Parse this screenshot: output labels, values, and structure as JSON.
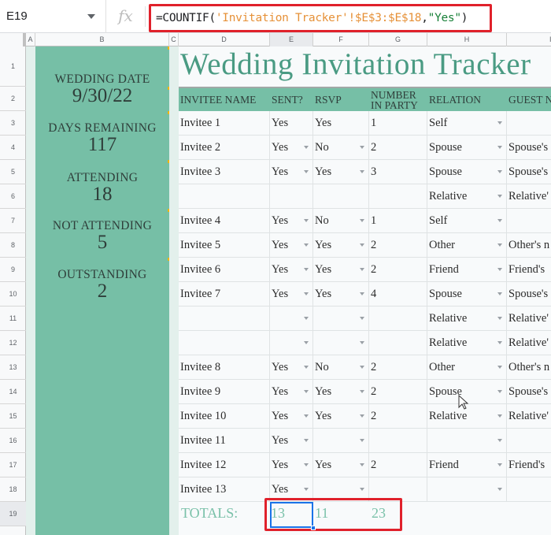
{
  "formula_bar": {
    "name_box": "E19",
    "fx_icon": "fx",
    "formula_prefix": "=COUNTIF(",
    "formula_ref": "'Invitation Tracker'!$E$3:$E$18",
    "formula_sep": ",",
    "formula_str": "\"Yes\"",
    "formula_suffix": ")"
  },
  "columns": [
    "A",
    "B",
    "C",
    "D",
    "E",
    "F",
    "G",
    "H",
    "I"
  ],
  "selected_column": "E",
  "rows": [
    "1",
    "2",
    "3",
    "4",
    "5",
    "6",
    "7",
    "8",
    "9",
    "10",
    "11",
    "12",
    "13",
    "14",
    "15",
    "16",
    "17",
    "18",
    "19"
  ],
  "selected_row": "19",
  "summary": {
    "wedding_date_label": "WEDDING DATE",
    "wedding_date": "9/30/22",
    "days_remaining_label": "DAYS REMAINING",
    "days_remaining": "117",
    "attending_label": "ATTENDING",
    "attending": "18",
    "not_attending_label": "NOT ATTENDING",
    "not_attending": "5",
    "outstanding_label": "OUTSTANDING",
    "outstanding": "2"
  },
  "title": "Wedding Invitation Tracker",
  "table": {
    "headers": [
      "INVITEE NAME",
      "SENT?",
      "RSVP",
      "NUMBER IN PARTY",
      "RELATION",
      "GUEST N"
    ],
    "header_party_line1": "NUMBER",
    "header_party_line2": "IN PARTY",
    "rows": [
      {
        "name": "Invitee 1",
        "sent": "Yes",
        "rsvp": "Yes",
        "party": "1",
        "relation": "Self",
        "guest": ""
      },
      {
        "name": "Invitee 2",
        "sent": "Yes",
        "rsvp": "No",
        "party": "2",
        "relation": "Spouse",
        "guest": "Spouse's"
      },
      {
        "name": "Invitee 3",
        "sent": "Yes",
        "rsvp": "Yes",
        "party": "3",
        "relation": "Spouse",
        "guest": "Spouse's"
      },
      {
        "name": "",
        "sent": "",
        "rsvp": "",
        "party": "",
        "relation": "Relative",
        "guest": "Relative'"
      },
      {
        "name": "Invitee 4",
        "sent": "Yes",
        "rsvp": "No",
        "party": "1",
        "relation": "Self",
        "guest": ""
      },
      {
        "name": "Invitee 5",
        "sent": "Yes",
        "rsvp": "Yes",
        "party": "2",
        "relation": "Other",
        "guest": "Other's n"
      },
      {
        "name": "Invitee 6",
        "sent": "Yes",
        "rsvp": "Yes",
        "party": "2",
        "relation": "Friend",
        "guest": "Friend's"
      },
      {
        "name": "Invitee 7",
        "sent": "Yes",
        "rsvp": "Yes",
        "party": "4",
        "relation": "Spouse",
        "guest": "Spouse's"
      },
      {
        "name": "",
        "sent": "",
        "rsvp": "",
        "party": "",
        "relation": "Relative",
        "guest": "Relative'"
      },
      {
        "name": "",
        "sent": "",
        "rsvp": "",
        "party": "",
        "relation": "Relative",
        "guest": "Relative'"
      },
      {
        "name": "Invitee 8",
        "sent": "Yes",
        "rsvp": "No",
        "party": "2",
        "relation": "Other",
        "guest": "Other's n"
      },
      {
        "name": "Invitee 9",
        "sent": "Yes",
        "rsvp": "Yes",
        "party": "2",
        "relation": "Spouse",
        "guest": "Spouse's"
      },
      {
        "name": "Invitee 10",
        "sent": "Yes",
        "rsvp": "Yes",
        "party": "2",
        "relation": "Relative",
        "guest": "Relative'"
      },
      {
        "name": "Invitee 11",
        "sent": "Yes",
        "rsvp": "",
        "party": "",
        "relation": "",
        "guest": ""
      },
      {
        "name": "Invitee 12",
        "sent": "Yes",
        "rsvp": "Yes",
        "party": "2",
        "relation": "Friend",
        "guest": "Friend's"
      },
      {
        "name": "Invitee 13",
        "sent": "Yes",
        "rsvp": "",
        "party": "",
        "relation": "",
        "guest": ""
      }
    ],
    "dropdowns": [
      {
        "sent": false,
        "rsvp": false,
        "relation": true
      },
      {
        "sent": true,
        "rsvp": true,
        "relation": true
      },
      {
        "sent": true,
        "rsvp": true,
        "relation": true
      },
      {
        "sent": false,
        "rsvp": false,
        "relation": true
      },
      {
        "sent": true,
        "rsvp": true,
        "relation": true
      },
      {
        "sent": true,
        "rsvp": true,
        "relation": true
      },
      {
        "sent": true,
        "rsvp": true,
        "relation": true
      },
      {
        "sent": true,
        "rsvp": true,
        "relation": true
      },
      {
        "sent": true,
        "rsvp": true,
        "relation": true
      },
      {
        "sent": true,
        "rsvp": true,
        "relation": true
      },
      {
        "sent": true,
        "rsvp": true,
        "relation": true
      },
      {
        "sent": true,
        "rsvp": true,
        "relation": true
      },
      {
        "sent": true,
        "rsvp": true,
        "relation": true
      },
      {
        "sent": true,
        "rsvp": true,
        "relation": true
      },
      {
        "sent": true,
        "rsvp": true,
        "relation": true
      },
      {
        "sent": true,
        "rsvp": true,
        "relation": true
      }
    ]
  },
  "totals": {
    "label": "TOTALS:",
    "sent": "13",
    "rsvp": "11",
    "party": "23"
  },
  "colors": {
    "panel": "#76bfa6",
    "title": "#4a9b83",
    "totals": "#7ac1a9",
    "highlight": "#e0212b",
    "selection": "#1a73e8"
  }
}
